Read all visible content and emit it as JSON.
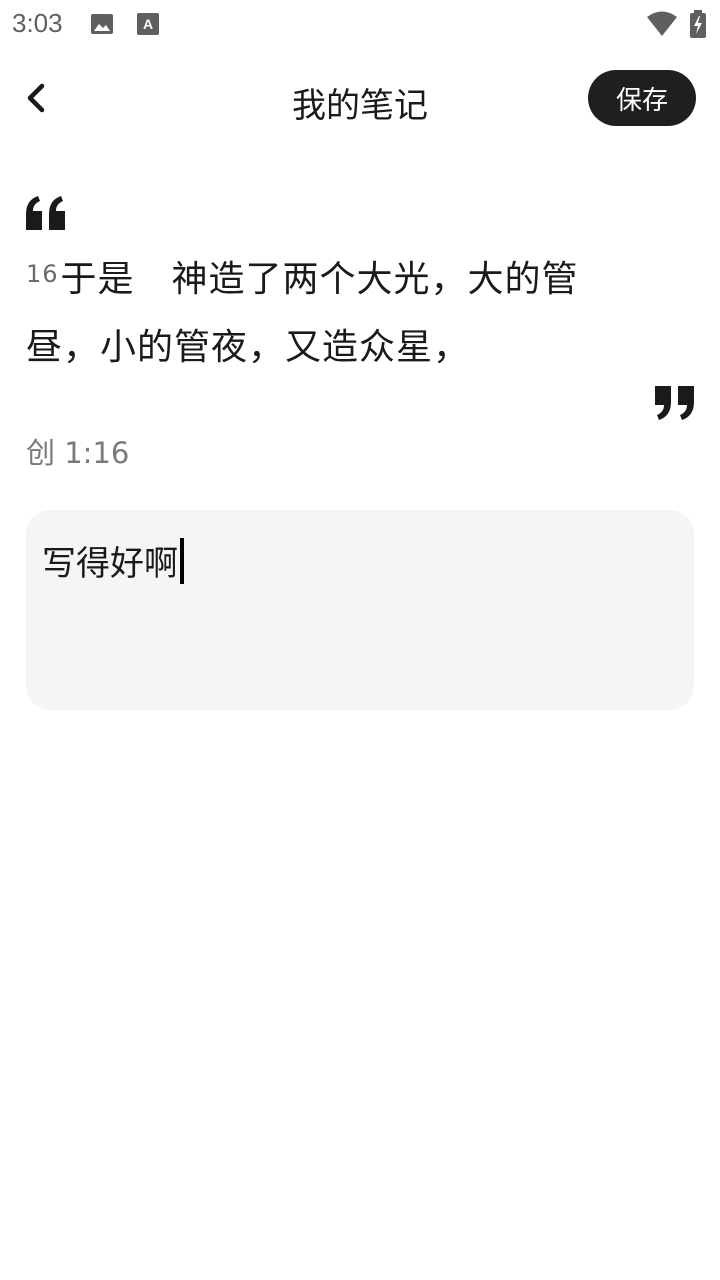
{
  "status_bar": {
    "time": "3:03",
    "icons": [
      "image-icon",
      "keyboard-a-icon",
      "wifi-icon",
      "battery-charging-icon"
    ]
  },
  "header": {
    "title": "我的笔记",
    "save_label": "保存",
    "back_icon": "chevron-left-icon"
  },
  "quote": {
    "verse_number": "16",
    "verse_text": "于是　神造了两个大光，大的管昼，小的管夜，又造众星，",
    "reference": "创 1:16"
  },
  "note": {
    "value": "写得好啊"
  },
  "colors": {
    "save_bg": "#1f1f1f",
    "note_bg": "#f5f5f5",
    "reference": "#7a7a7a"
  }
}
